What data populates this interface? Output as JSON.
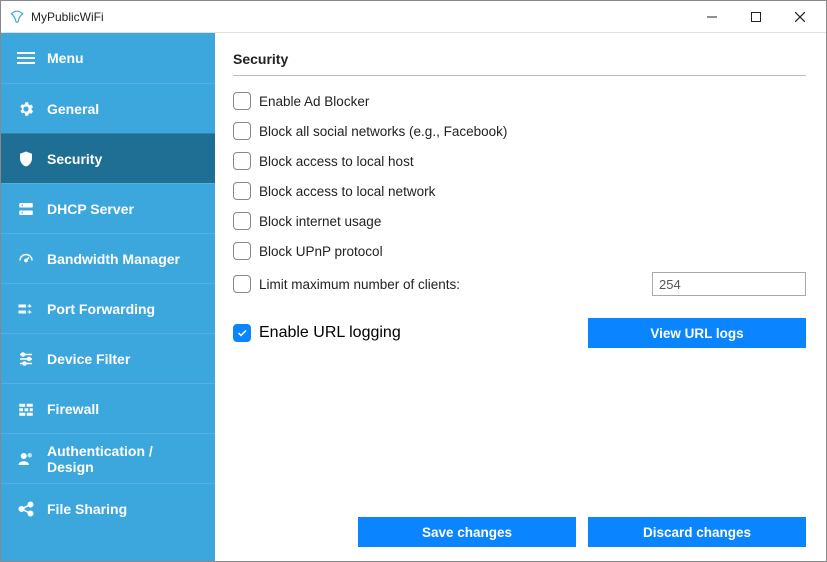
{
  "window": {
    "title": "MyPublicWiFi"
  },
  "sidebar": {
    "items": [
      {
        "label": "Menu"
      },
      {
        "label": "General"
      },
      {
        "label": "Security"
      },
      {
        "label": "DHCP Server"
      },
      {
        "label": "Bandwidth Manager"
      },
      {
        "label": "Port Forwarding"
      },
      {
        "label": "Device Filter"
      },
      {
        "label": "Firewall"
      },
      {
        "label": "Authentication / Design"
      },
      {
        "label": "File Sharing"
      }
    ]
  },
  "section": {
    "title": "Security"
  },
  "options": {
    "adblocker": {
      "label": "Enable Ad Blocker",
      "checked": false
    },
    "block_social": {
      "label": "Block all social networks (e.g., Facebook)",
      "checked": false
    },
    "block_localhost": {
      "label": "Block access to local host",
      "checked": false
    },
    "block_localnet": {
      "label": "Block access to local network",
      "checked": false
    },
    "block_internet": {
      "label": "Block internet usage",
      "checked": false
    },
    "block_upnp": {
      "label": "Block UPnP protocol",
      "checked": false
    },
    "limit_clients": {
      "label": "Limit maximum number of clients:",
      "checked": false,
      "value": "254"
    },
    "url_logging": {
      "label": "Enable URL logging",
      "checked": true
    }
  },
  "buttons": {
    "view_url_logs": "View URL logs",
    "save": "Save changes",
    "discard": "Discard changes"
  }
}
